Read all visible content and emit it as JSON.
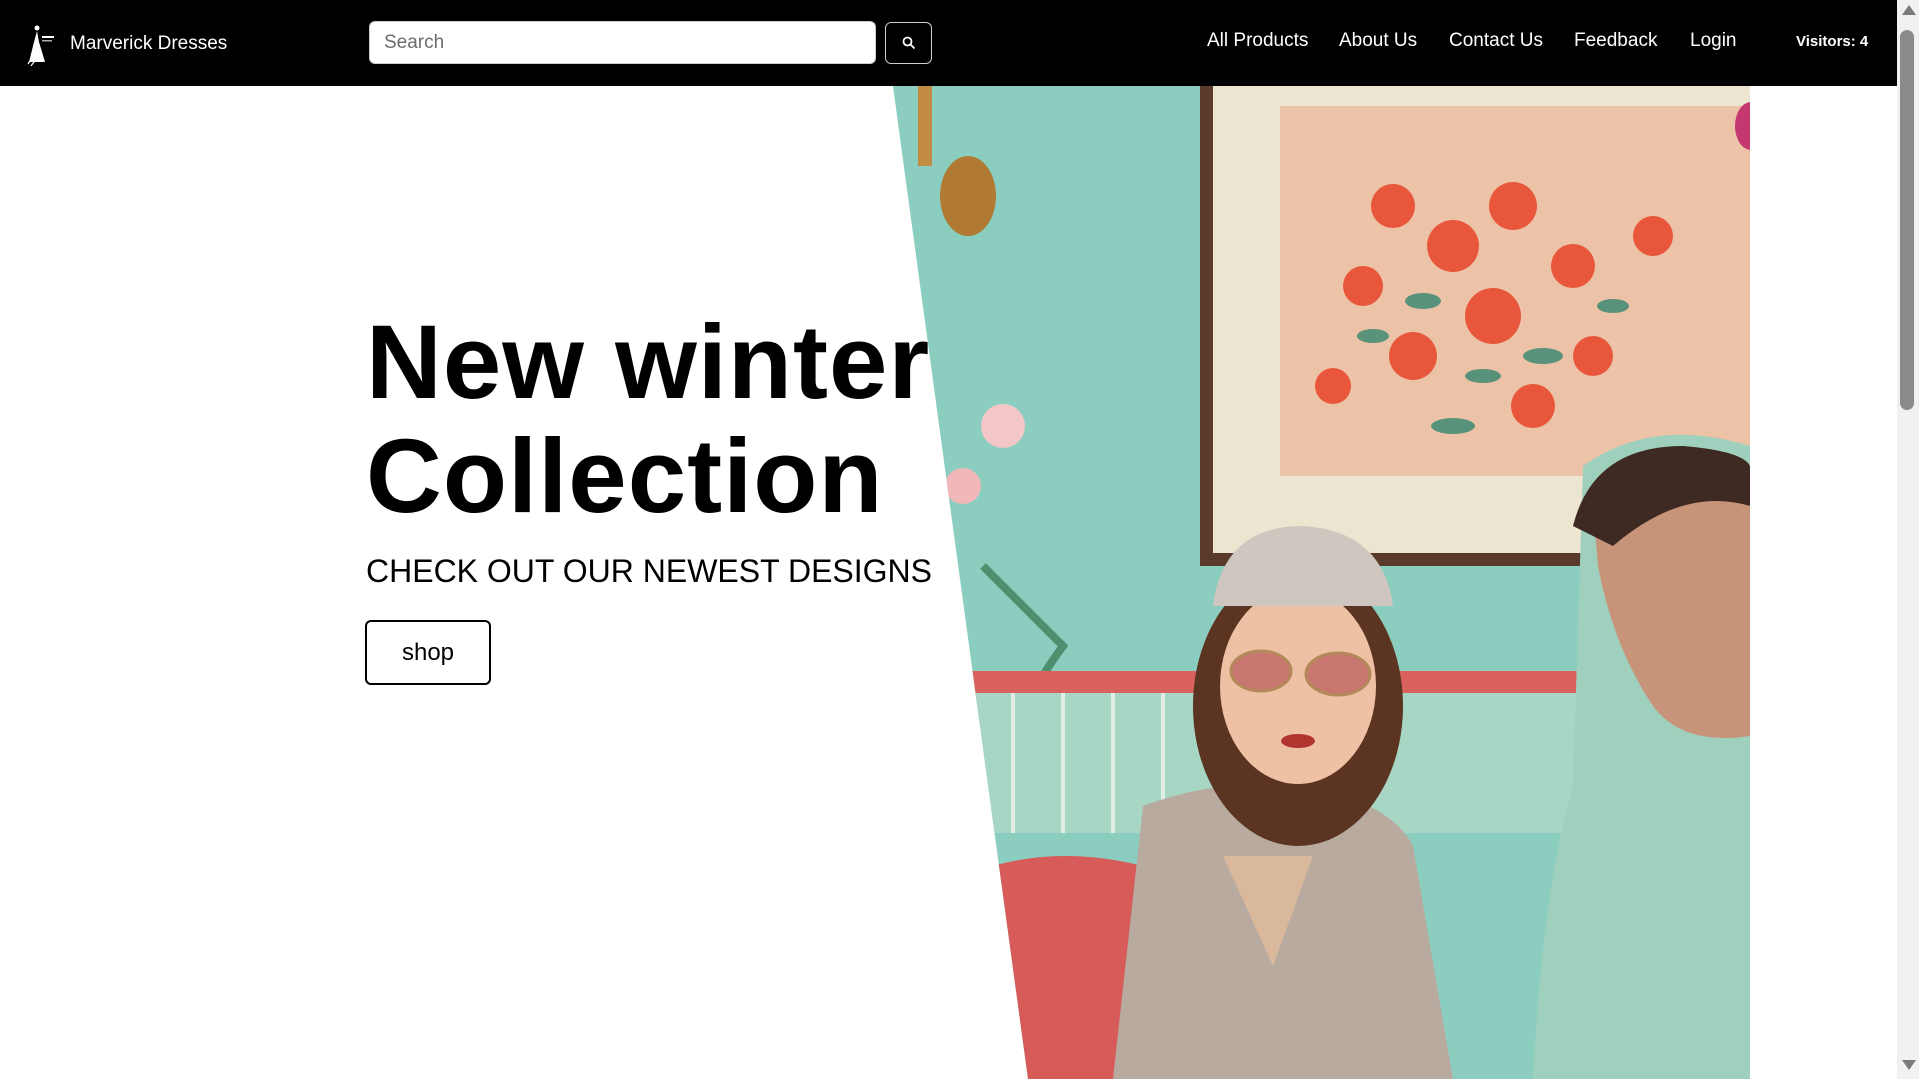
{
  "navbar": {
    "brand_name": "Marverick Dresses",
    "logo_icon": "dress-figure-logo",
    "search_placeholder": "Search",
    "search_icon": "search-icon",
    "links": [
      "All Products",
      "About Us",
      "Contact Us",
      "Feedback",
      "Login"
    ],
    "visitors": "Visitors: 4"
  },
  "hero": {
    "title_line1": "New winter",
    "title_line2": "Collection",
    "subtitle": "CHECK OUT OUR NEWEST DESIGNS",
    "shop_label": "shop",
    "image_subject": "fashion-couple-photo"
  },
  "colors": {
    "navbar_bg": "#000000",
    "nav_text": "#ffffff",
    "page_bg": "#ffffff",
    "wall_teal": "#8fd3c3",
    "sofa_red": "#d9625e"
  }
}
